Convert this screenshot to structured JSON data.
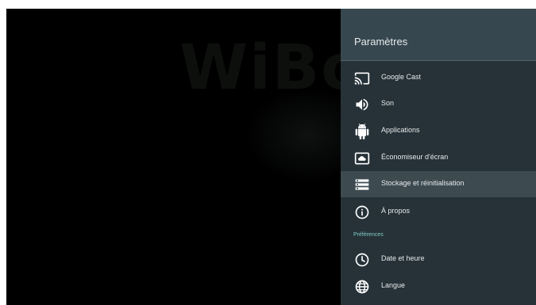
{
  "background": {
    "logo_text": "WiBox"
  },
  "panel": {
    "title": "Paramètres",
    "items": [
      {
        "label": "Google Cast",
        "icon": "cast-icon"
      },
      {
        "label": "Son",
        "icon": "volume-icon"
      },
      {
        "label": "Applications",
        "icon": "android-icon"
      },
      {
        "label": "Économiseur d'écran",
        "icon": "screensaver-icon"
      },
      {
        "label": "Stockage et réinitialisation",
        "icon": "storage-icon",
        "selected": true
      },
      {
        "label": "À propos",
        "icon": "info-icon"
      }
    ],
    "section_label": "Préférences",
    "pref_items": [
      {
        "label": "Date et heure",
        "icon": "clock-icon"
      },
      {
        "label": "Langue",
        "icon": "globe-icon"
      }
    ]
  },
  "colors": {
    "panel_bg": "#263238",
    "header_bg": "#37474f",
    "selected_bg": "#3d4b51",
    "section_accent": "#80cbc4"
  }
}
